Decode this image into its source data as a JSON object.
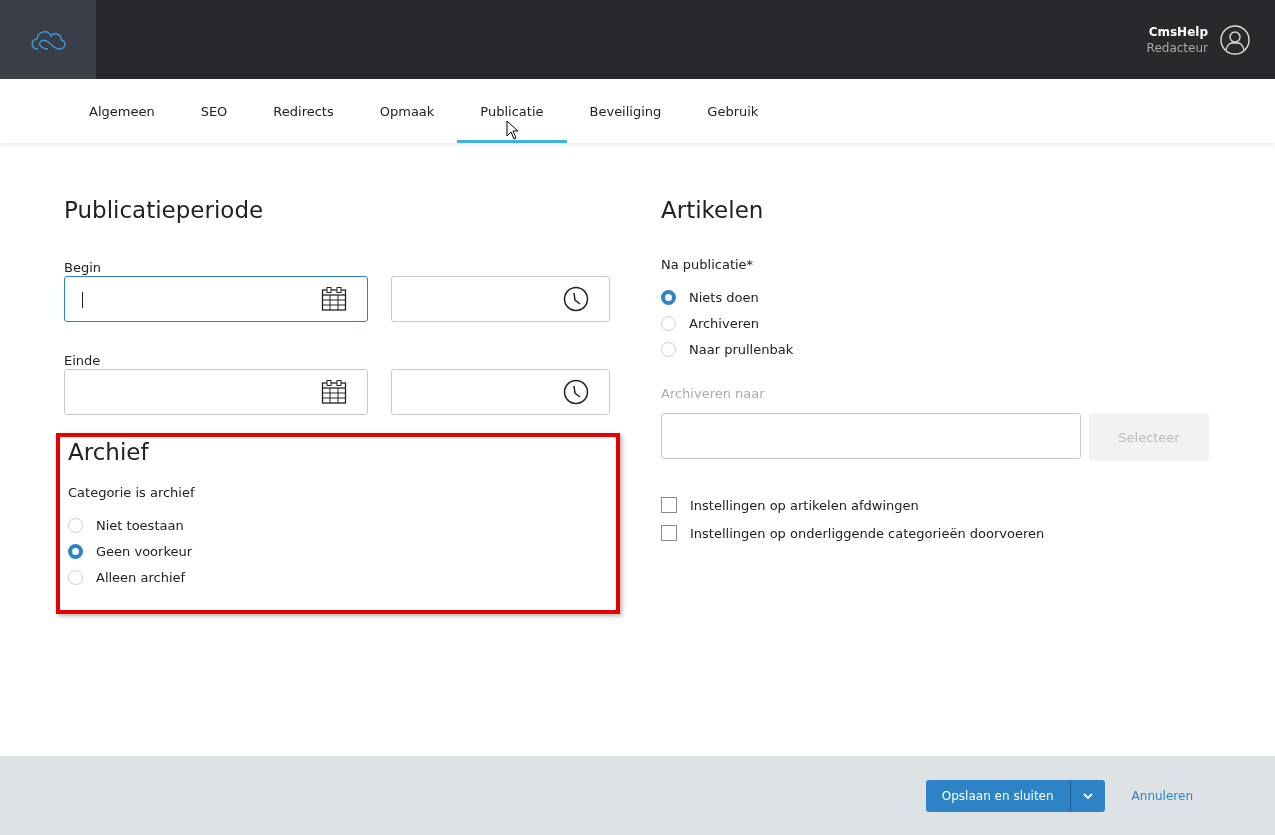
{
  "header": {
    "user_name": "CmsHelp",
    "user_role": "Redacteur"
  },
  "tabs": [
    {
      "label": "Algemeen",
      "selected": false
    },
    {
      "label": "SEO",
      "selected": false
    },
    {
      "label": "Redirects",
      "selected": false
    },
    {
      "label": "Opmaak",
      "selected": false
    },
    {
      "label": "Publicatie",
      "selected": true
    },
    {
      "label": "Beveiliging",
      "selected": false
    },
    {
      "label": "Gebruik",
      "selected": false
    }
  ],
  "publication": {
    "title": "Publicatieperiode",
    "fields": [
      {
        "label": "Begin",
        "date_focused": true
      },
      {
        "label": "Einde",
        "date_focused": false
      }
    ]
  },
  "archive": {
    "title": "Archief",
    "highlighted": true,
    "label": "Categorie is archief",
    "options": [
      {
        "label": "Niet toestaan",
        "selected": false
      },
      {
        "label": "Geen voorkeur",
        "selected": true
      },
      {
        "label": "Alleen archief",
        "selected": false
      }
    ]
  },
  "articles": {
    "title": "Artikelen",
    "label": "Na publicatie*",
    "options": [
      {
        "label": "Niets doen",
        "selected": true
      },
      {
        "label": "Archiveren",
        "selected": false
      },
      {
        "label": "Naar prullenbak",
        "selected": false
      }
    ],
    "archive_to": {
      "label": "Archiveren naar",
      "disabled": true,
      "button": "Selecteer"
    },
    "checkboxes": [
      {
        "label": "Instellingen op artikelen afdwingen",
        "checked": false
      },
      {
        "label": "Instellingen op onderliggende categorieën doorvoeren",
        "checked": false
      }
    ]
  },
  "footer": {
    "save_button": "Opslaan en sluiten",
    "cancel_link": "Annuleren"
  }
}
